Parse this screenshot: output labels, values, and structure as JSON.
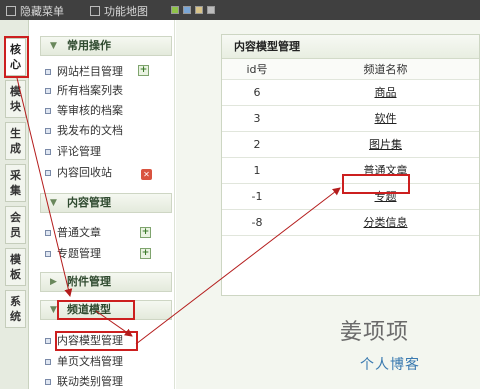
{
  "topbar": {
    "hide_menu": "隐藏菜单",
    "function_map": "功能地图"
  },
  "left_tabs": [
    "核心",
    "模块",
    "生成",
    "采集",
    "会员",
    "模板",
    "系统"
  ],
  "sidebar": {
    "group_common": "常用操作",
    "common_items": [
      "网站栏目管理",
      "所有档案列表",
      "等审核的档案",
      "我发布的文档",
      "评论管理",
      "内容回收站"
    ],
    "group_content": "内容管理",
    "content_items": [
      "普通文章",
      "专题管理"
    ],
    "group_attachment": "附件管理",
    "group_channel": "频道模型",
    "channel_items": [
      "内容模型管理",
      "单页文档管理",
      "联动类别管理"
    ]
  },
  "panel": {
    "title": "内容模型管理",
    "col_id": "id号",
    "col_name": "频道名称",
    "rows": [
      {
        "id": "6",
        "name": "商品"
      },
      {
        "id": "3",
        "name": "软件"
      },
      {
        "id": "2",
        "name": "图片集"
      },
      {
        "id": "1",
        "name": "普通文章"
      },
      {
        "id": "-1",
        "name": "专题"
      },
      {
        "id": "-8",
        "name": "分类信息"
      }
    ]
  },
  "watermark": {
    "name": "姜项项",
    "subtitle": "个人博客"
  },
  "colors": {
    "highlight": "#cc1f1f",
    "topbar": "#404040",
    "sidebar_group": "#2f4a2f"
  }
}
